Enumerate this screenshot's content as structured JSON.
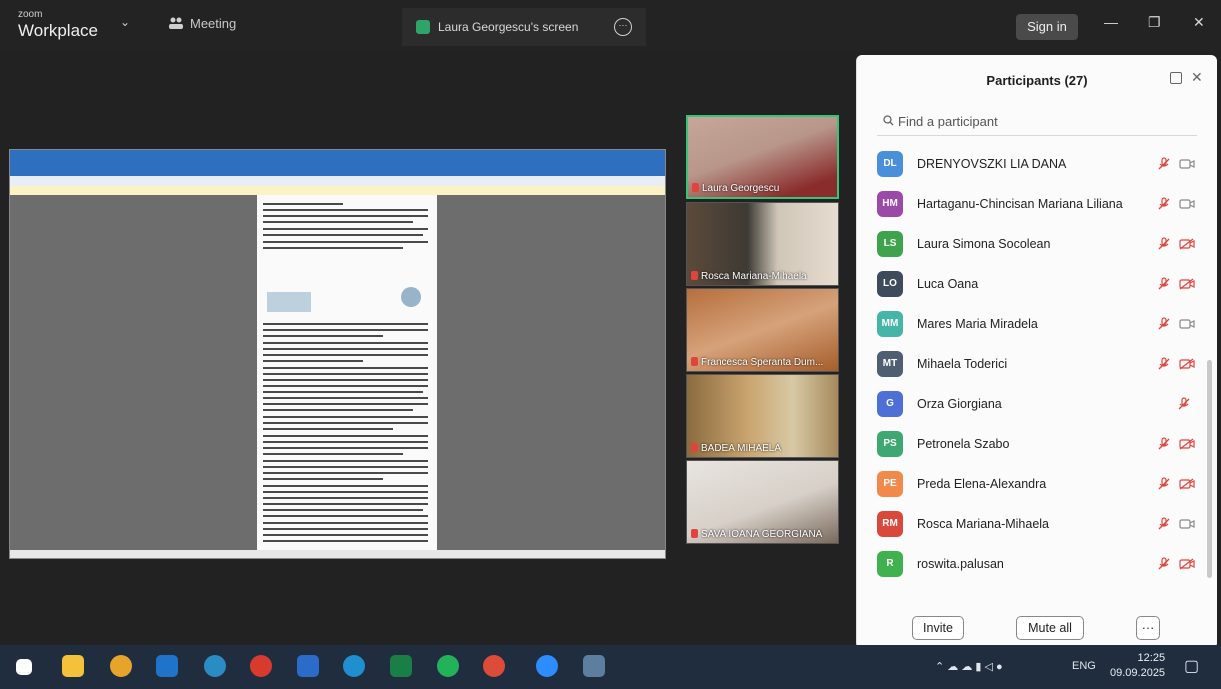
{
  "titlebar": {
    "brand_small": "zoom",
    "brand_big": "Workplace",
    "meeting_tab": "Meeting",
    "screen_tab": "Laura Georgescu's screen",
    "more": "···",
    "sign_in": "Sign in",
    "minimize": "—",
    "restore": "❐",
    "close": "✕"
  },
  "tiles": [
    {
      "name": "Laura Georgescu"
    },
    {
      "name": "Rosca Mariana-Mihaela"
    },
    {
      "name": "Francesca Speranta Dum..."
    },
    {
      "name": "BADEA MIHAELA"
    },
    {
      "name": "SAVA IOANA GEORGIANA"
    }
  ],
  "participants": {
    "title": "Participants (27)",
    "search_placeholder": "Find a participant",
    "items": [
      {
        "initials": "DL",
        "name": "DRENYOVSZKI LIA DANA",
        "color": "#4a8fd9",
        "video": "on"
      },
      {
        "initials": "HM",
        "name": "Hartaganu-Chincisan Mariana Liliana",
        "color": "#9b4aa7",
        "video": "on"
      },
      {
        "initials": "LS",
        "name": "Laura Simona Socolean",
        "color": "#3fa34d",
        "video": "off"
      },
      {
        "initials": "LO",
        "name": "Luca Oana",
        "color": "#3d4b5c",
        "video": "off"
      },
      {
        "initials": "MM",
        "name": "Mares Maria Miradela",
        "color": "#44b5a6",
        "video": "on"
      },
      {
        "initials": "MT",
        "name": "Mihaela Toderici",
        "color": "#4f5e70",
        "video": "off"
      },
      {
        "initials": "G",
        "name": "Orza Giorgiana",
        "color": "#4e6fd6",
        "video": "none"
      },
      {
        "initials": "PS",
        "name": "Petronela Szabo",
        "color": "#3ea873",
        "video": "off"
      },
      {
        "initials": "PE",
        "name": "Preda Elena-Alexandra",
        "color": "#f0894a",
        "video": "off"
      },
      {
        "initials": "RM",
        "name": "Rosca Mariana-Mihaela",
        "color": "#d9483b",
        "video": "on"
      },
      {
        "initials": "R",
        "name": "roswita.palusan",
        "color": "#3fb24f",
        "video": "off"
      }
    ],
    "invite": "Invite",
    "mute_all": "Mute all",
    "more": "···"
  },
  "taskbar": {
    "lang": "ENG",
    "time": "12:25",
    "date": "09.09.2025"
  },
  "colors": {
    "mic_off": "#e0443e",
    "active_speaker": "#39c27a"
  }
}
